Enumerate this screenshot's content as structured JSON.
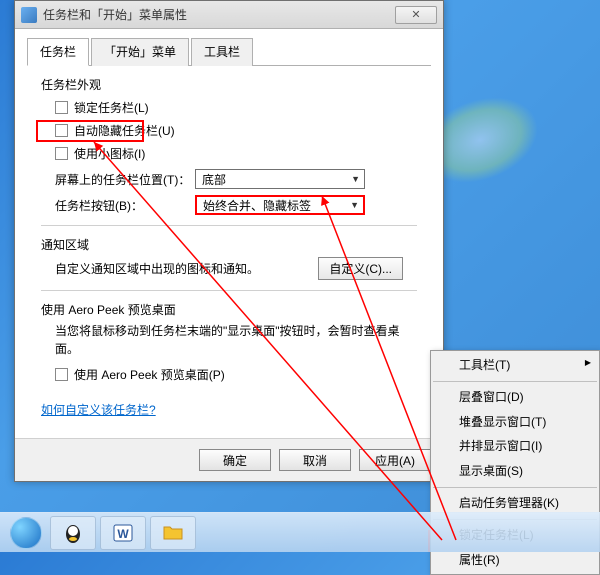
{
  "dialog": {
    "title": "任务栏和「开始」菜单属性",
    "tabs": [
      "任务栏",
      "「开始」菜单",
      "工具栏"
    ],
    "appearance_label": "任务栏外观",
    "lock": "锁定任务栏(L)",
    "autohide": "自动隐藏任务栏(U)",
    "small_icons": "使用小图标(I)",
    "position_label": "屏幕上的任务栏位置(T)：",
    "position_value": "底部",
    "buttons_label": "任务栏按钮(B)：",
    "buttons_value": "始终合并、隐藏标签",
    "notify_label": "通知区域",
    "notify_desc": "自定义通知区域中出现的图标和通知。",
    "customize_btn": "自定义(C)...",
    "aero_label": "使用 Aero Peek 预览桌面",
    "aero_desc": "当您将鼠标移动到任务栏末端的\"显示桌面\"按钮时，会暂时查看桌面。",
    "aero_check": "使用 Aero Peek 预览桌面(P)",
    "help_link": "如何自定义该任务栏?",
    "ok": "确定",
    "cancel": "取消",
    "apply": "应用(A)"
  },
  "menu": {
    "toolbars": "工具栏(T)",
    "cascade": "层叠窗口(D)",
    "stack": "堆叠显示窗口(T)",
    "sidebyside": "并排显示窗口(I)",
    "show_desktop": "显示桌面(S)",
    "taskmgr": "启动任务管理器(K)",
    "lock": "锁定任务栏(L)",
    "properties": "属性(R)"
  },
  "colors": {
    "highlight": "#ff0000"
  }
}
